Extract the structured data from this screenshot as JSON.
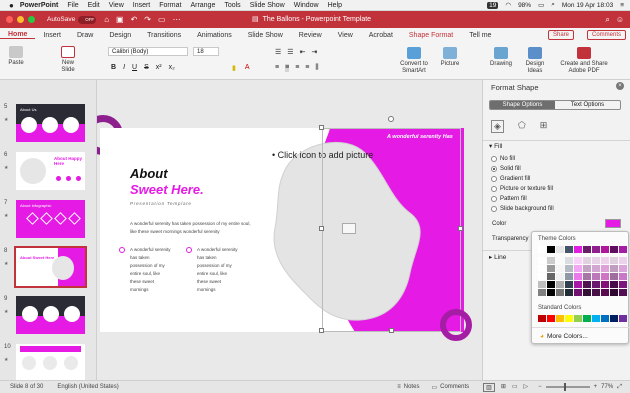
{
  "menubar": {
    "app_name": "PowerPoint",
    "items": [
      "File",
      "Edit",
      "View",
      "Insert",
      "Format",
      "Arrange",
      "Tools",
      "Slide Show",
      "Window",
      "Help"
    ],
    "badge": "19",
    "battery": "98%",
    "clock": "Mon 19 Apr  18:03"
  },
  "titlebar": {
    "autosave_label": "AutoSave",
    "autosave_state": "OFF",
    "doc_title": "The Ballons - Powerpoint Template",
    "search_placeholder": "",
    "brand_color": "#c2323a"
  },
  "tabs": [
    "Home",
    "Insert",
    "Draw",
    "Design",
    "Transitions",
    "Animations",
    "Slide Show",
    "Review",
    "View",
    "Acrobat",
    "Shape Format",
    "Tell me"
  ],
  "share_label": "Share",
  "comments_label": "Comments",
  "ribbon": {
    "paste": "Paste",
    "new_slide_1": "New",
    "new_slide_2": "Slide",
    "font_name": "Calibri (Body)",
    "font_size": "18",
    "format_buttons": [
      "B",
      "I",
      "U",
      "S",
      "x²",
      "x₂"
    ],
    "convert_1": "Convert to",
    "convert_2": "SmartArt",
    "picture": "Picture",
    "drawing": "Drawing",
    "design_ideas_1": "Design",
    "design_ideas_2": "Ideas",
    "adobe_1": "Create and Share",
    "adobe_2": "Adobe PDF"
  },
  "thumbnails": [
    {
      "num": "5",
      "title": "About Us"
    },
    {
      "num": "6",
      "title": "About Happy Here"
    },
    {
      "num": "7",
      "title": "About Infographic"
    },
    {
      "num": "8",
      "title": "About Sweet Here"
    },
    {
      "num": "9",
      "title": "Team"
    },
    {
      "num": "10",
      "title": ""
    }
  ],
  "slide": {
    "title_line1": "About",
    "title_line2": "Sweet Here.",
    "subtitle": "Presentation Template",
    "paragraph": "A wonderful serenity has taken possession of my entire soul, like these sweet mornings wonderful serenity",
    "col1": "A wonderful serenity has taken possession of my entire soul, like these sweet mornings",
    "col2": "A wonderful serenity has taken possession of my entire soul, like these sweet mornings",
    "placeholder": "• Click icon to add picture",
    "banner": "A wonderful serenity Has"
  },
  "pane": {
    "title": "Format Shape",
    "seg_left": "Shape Options",
    "seg_right": "Text Options",
    "fill_heading": "Fill",
    "fill_options": [
      "No fill",
      "Solid fill",
      "Gradient fill",
      "Picture or texture fill",
      "Pattern fill",
      "Slide background fill"
    ],
    "color_label": "Color",
    "transparency_label": "Transparency",
    "line_heading": "Line"
  },
  "popup": {
    "theme_title": "Theme Colors",
    "standard_title": "Standard Colors",
    "more_colors": "More Colors...",
    "theme_top": [
      "#ffffff",
      "#000000",
      "#e7e6e6",
      "#44546a",
      "#e020e0",
      "#6a1b6a",
      "#8e1f8e",
      "#b0179d",
      "#5f0e5f",
      "#a51da5"
    ],
    "standard": [
      "#c00000",
      "#ff0000",
      "#ffc000",
      "#ffff00",
      "#92d050",
      "#00b050",
      "#00b0f0",
      "#0070c0",
      "#002060",
      "#7030a0"
    ]
  },
  "status": {
    "slide_info": "Slide 8 of 30",
    "language": "English (United States)",
    "notes": "Notes",
    "comments": "Comments",
    "zoom": "77%"
  },
  "accent": "#e51be5"
}
